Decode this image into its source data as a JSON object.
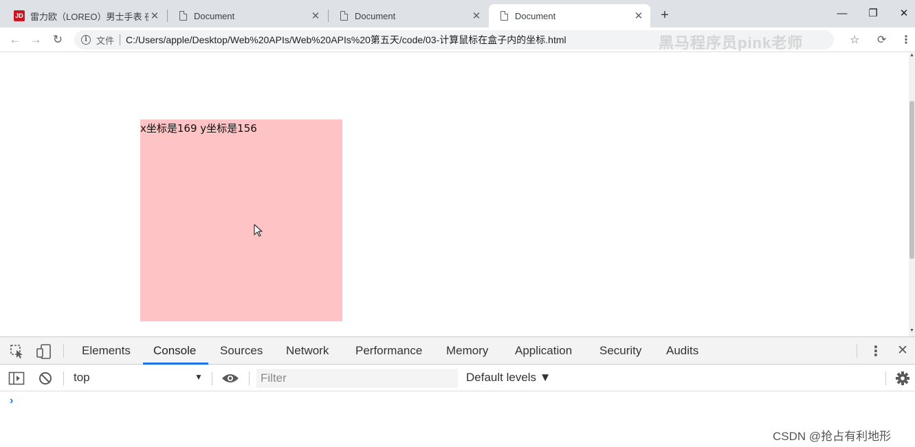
{
  "browser": {
    "tabs": [
      {
        "title": "雷力欧（LOREO）男士手表 夜光",
        "icon": "jd-logo",
        "icon_text": "JD",
        "active": false
      },
      {
        "title": "Document",
        "icon": "page-icon",
        "active": false
      },
      {
        "title": "Document",
        "icon": "page-icon",
        "active": false
      },
      {
        "title": "Document",
        "icon": "page-icon",
        "active": true
      }
    ],
    "tab_close_glyph": "✕",
    "new_tab_glyph": "+",
    "window_controls": {
      "minimize": "—",
      "restore": "❐",
      "close": "✕"
    },
    "toolbar": {
      "back_glyph": "←",
      "forward_glyph": "→",
      "reload_glyph": "↻",
      "info_glyph": "i",
      "url_scheme_label": "文件",
      "url": "C:/Users/apple/Desktop/Web%20APIs/Web%20APIs%20第五天/code/03-计算鼠标在盒子内的坐标.html",
      "star_glyph": "☆",
      "sync_glyph": "⟳",
      "menu_glyph": "⋮"
    },
    "watermark": "黑马程序员pink老师"
  },
  "page": {
    "box_text": "x坐标是169 y坐标是156",
    "box_color": "#fdc3c5"
  },
  "devtools": {
    "tabs": [
      "Elements",
      "Console",
      "Sources",
      "Network",
      "Performance",
      "Memory",
      "Application",
      "Security",
      "Audits"
    ],
    "active_tab": "Console",
    "accent_color": "#1a73e8",
    "console": {
      "context": "top",
      "filter_placeholder": "Filter",
      "levels": "Default levels ▼",
      "prompt": "›"
    }
  },
  "overlay": {
    "csdn_watermark": "CSDN @抢占有利地形"
  }
}
